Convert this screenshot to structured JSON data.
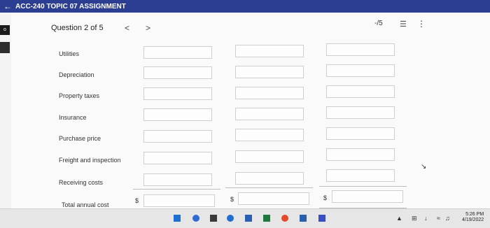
{
  "app": {
    "title": "ACC-240 TOPIC 07 ASSIGNMENT",
    "back_icon": "back-arrow-icon"
  },
  "rail": {
    "badge": "o"
  },
  "header": {
    "question_label": "Question 2 of 5",
    "prev_label": "<",
    "next_label": ">",
    "score": "-/5",
    "list_icon_glyph": "☰",
    "more_icon_glyph": "⋮"
  },
  "rows": [
    {
      "label": "Utilities"
    },
    {
      "label": "Depreciation"
    },
    {
      "label": "Property taxes"
    },
    {
      "label": "Insurance"
    },
    {
      "label": "Purchase price"
    },
    {
      "label": "Freight and inspection"
    },
    {
      "label": "Receiving costs"
    },
    {
      "label": "Total annual cost"
    }
  ],
  "totals": {
    "currency_symbol": "$"
  },
  "clock": {
    "time": "5:26 PM",
    "date": "4/19/2022"
  },
  "colors": {
    "topbar": "#2c3e91"
  }
}
